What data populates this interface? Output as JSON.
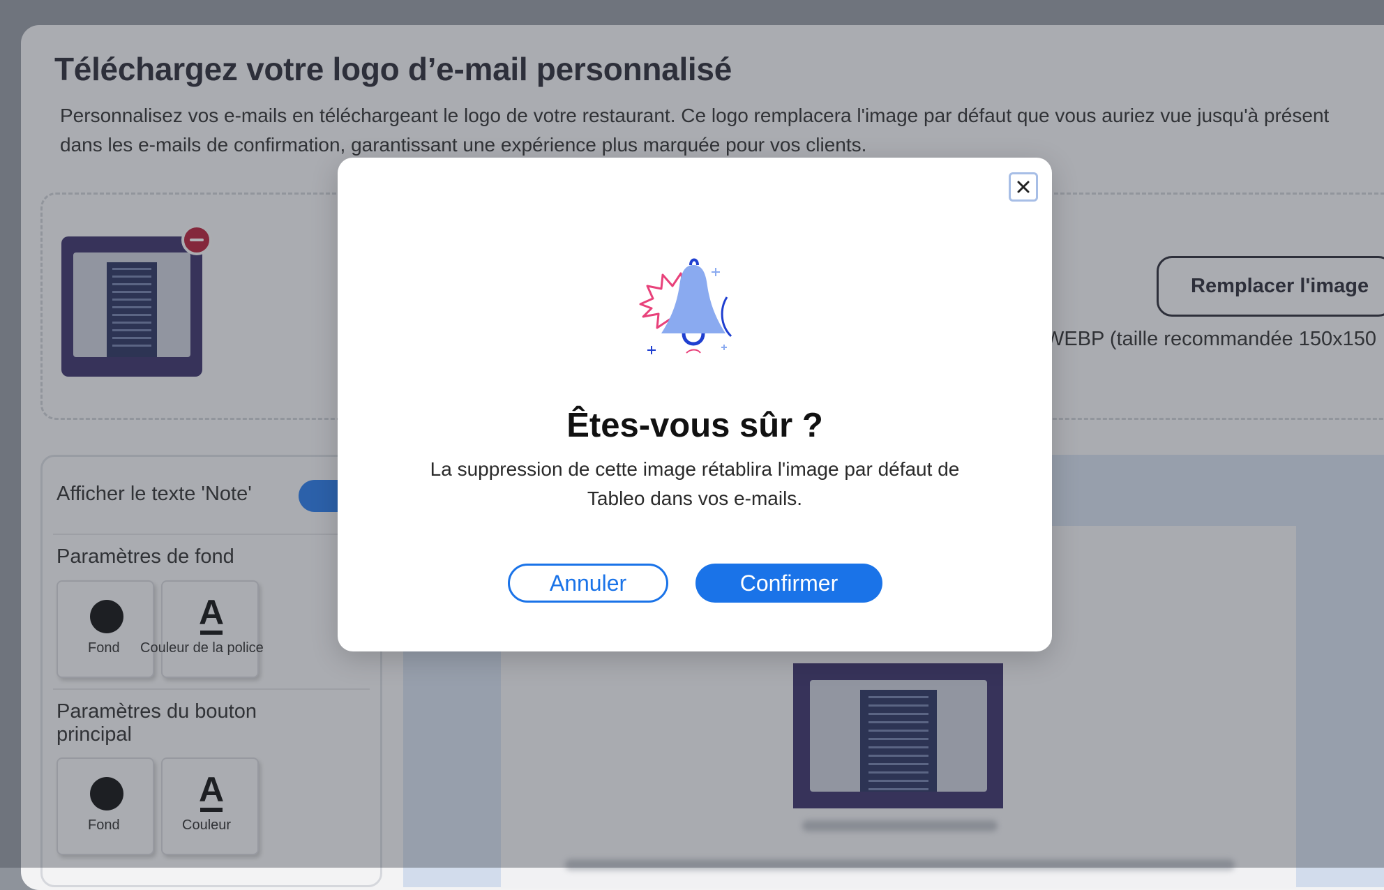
{
  "page": {
    "title": "Téléchargez votre logo d’e-mail personnalisé",
    "description": "Personnalisez vos e-mails en téléchargeant le logo de votre restaurant. Ce logo remplacera l'image par défaut que vous auriez vue jusqu'à présent dans les e-mails de confirmation, garantissant une expérience plus marquée pour vos clients."
  },
  "upload": {
    "replace_label": "Remplacer l'image",
    "format_hint": "WEBP (taille recommandée 150x150"
  },
  "settings": {
    "note_toggle_label": "Afficher le texte 'Note'",
    "note_toggle_on": true,
    "background_section": "Paramètres de fond",
    "background_swatch_label": "Fond",
    "font_color_label": "Couleur de la police",
    "primary_button_section": "Paramètres du bouton principal",
    "button_bg_label": "Fond",
    "button_color_label": "Couleur"
  },
  "modal": {
    "title": "Êtes-vous sûr ?",
    "message": "La suppression de cette image rétablira l'image par défaut de Tableo dans vos e-mails.",
    "cancel_label": "Annuler",
    "confirm_label": "Confirmer",
    "close_icon": "close-icon",
    "illustration_icon": "bell-icon"
  },
  "colors": {
    "accent": "#1a73e8",
    "remove": "#b1112b",
    "thumbnail_bg": "#2e2460"
  }
}
